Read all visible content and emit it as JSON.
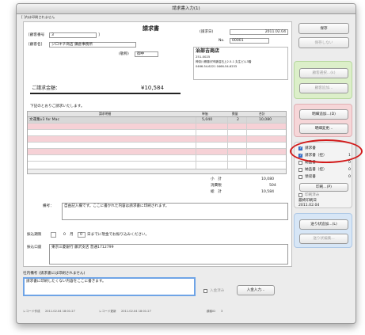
{
  "window_title": "請求書入力(1)",
  "top_note": "[ ]内は印刷されません",
  "doc_title": "請求書",
  "customer": {
    "num_label": "[顧客番号",
    "num_value": "3",
    "num_bracket": "]",
    "name_label": "[顧客名]",
    "name_value": "ジロキチ商店 鎌倉事務所",
    "honorific_label": "(敬称)",
    "honorific_value": "御中"
  },
  "invoice": {
    "date_label": "(請求日)",
    "date_value": "2011.02.04",
    "no_label": "No.",
    "no_value": "00001"
  },
  "issuer": {
    "name": "治部吉商店",
    "postal": "251-0025",
    "address": "神奈川県藤沢市鵠沼石上2-5-1 丸生ビル3階",
    "phone": "0466-54-6221  0466-54-6233"
  },
  "amount": {
    "label": "ご請求金額：",
    "value": "¥10,584"
  },
  "intro_text": "下記のとおりご請求いたします。",
  "table": {
    "headers": [
      "請求明細",
      "単価",
      "数量",
      "合計"
    ],
    "rows": [
      {
        "item": "文運集v3 for Mac",
        "price": "5,040",
        "qty": "2",
        "total": "10,080"
      }
    ]
  },
  "totals": {
    "subtotal_label": "小　計",
    "subtotal": "10,080",
    "tax_label": "消費税",
    "tax": "504",
    "total_label": "総　計",
    "total": "10,584"
  },
  "remarks": {
    "label": "備考：",
    "text": "自由記入欄です。ここに書かれた内容は請求書に印刷されます。"
  },
  "due": {
    "label": "振込期限",
    "month_suffix": "月",
    "month_value": "0",
    "day_value": "0",
    "day_text": "日までに現金でお振り込みください。"
  },
  "bank": {
    "label": "振込口座",
    "text": "東京三菱銀行 藤沢支店 普通1712799"
  },
  "internal": {
    "label": "社内備考 (請求書には印刷されません)",
    "text": "請求書に印刷したくない内容をここに書きます。"
  },
  "payment": {
    "received_label": "入金済み",
    "input_button": "入金入力..."
  },
  "footer": {
    "created_label": "レコード作成",
    "created": "2011.02.04 18:01:27",
    "updated_label": "レコード更新",
    "updated": "2011.02.04 18:01:27",
    "user_label": "顧客ID",
    "user_value": "3"
  },
  "side": {
    "save": "保存",
    "no_save": "保存しない",
    "customer_select": "顧客選択...(k)",
    "customer_add": "顧客追加...",
    "detail_add": "明細追加...(D)",
    "detail_change": "明細変更...",
    "print_options": [
      {
        "label": "請求書",
        "checked": true,
        "count": ""
      },
      {
        "label": "請求書（控）",
        "checked": true,
        "count": "1"
      },
      {
        "label": "納品書",
        "checked": false,
        "count": "0"
      },
      {
        "label": "納品書（控）",
        "checked": false,
        "count": "0"
      },
      {
        "label": "領収書",
        "checked": false,
        "count": "0"
      }
    ],
    "print_button": "印刷...(P)",
    "printed_label": "印刷済み",
    "last_print_label": "最終印刷日",
    "last_print_value": "2011.02.04",
    "delivery_add": "送り状追加...(L)",
    "delivery_edit": "送り状編集..."
  },
  "colors": {
    "highlight_oval": "#d21a1a",
    "pink_row": "#f6d1d6",
    "group_green": "#dcefc9",
    "group_pink": "#f6d6d8",
    "group_blue": "#d7e6f6"
  }
}
